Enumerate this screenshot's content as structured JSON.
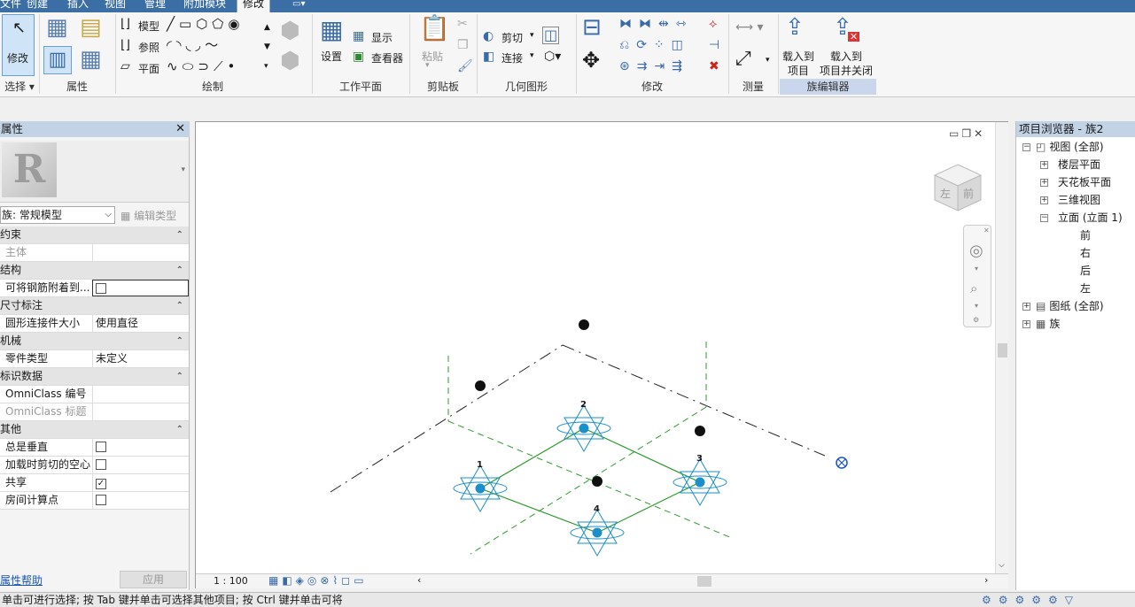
{
  "tabs": [
    "文件",
    "创建",
    "插入",
    "视图",
    "管理",
    "附加模块",
    "修改"
  ],
  "active_tab": "修改",
  "ribbon": {
    "modify_label": "修改",
    "select_label": "选择",
    "panels": {
      "properties": "属性",
      "draw": "绘制",
      "work_plane": "工作平面",
      "clipboard": "剪贴板",
      "geometry": "几何图形",
      "modify": "修改",
      "measure": "测量",
      "family_editor": "族编辑器"
    },
    "draw_items": [
      "模型",
      "参照",
      "平面"
    ],
    "work_plane_items": {
      "set": "设置",
      "show": "显示",
      "viewer": "查看器"
    },
    "clipboard_items": {
      "paste": "粘贴"
    },
    "geometry_items": {
      "cut": "剪切",
      "join": "连接"
    },
    "family_editor_items": {
      "load_to_project_1": "载入到",
      "load_to_project_2": "项目",
      "load_close_1": "载入到",
      "load_close_2": "项目并关闭"
    }
  },
  "properties": {
    "title": "属性",
    "type_selector": "族: 常规模型",
    "edit_type": "编辑类型",
    "groups": [
      {
        "name": "约束",
        "rows": [
          {
            "key": "主体",
            "value": "",
            "disabled": true
          }
        ]
      },
      {
        "name": "结构",
        "rows": [
          {
            "key": "可将钢筋附着到...",
            "checkbox": false
          }
        ]
      },
      {
        "name": "尺寸标注",
        "rows": [
          {
            "key": "圆形连接件大小",
            "value": "使用直径"
          }
        ]
      },
      {
        "name": "机械",
        "rows": [
          {
            "key": "零件类型",
            "value": "未定义"
          }
        ]
      },
      {
        "name": "标识数据",
        "rows": [
          {
            "key": "OmniClass 编号",
            "value": ""
          },
          {
            "key": "OmniClass 标题",
            "value": "",
            "disabled": true
          }
        ]
      },
      {
        "name": "其他",
        "rows": [
          {
            "key": "总是垂直",
            "checkbox": false
          },
          {
            "key": "加载时剪切的空心",
            "checkbox": false
          },
          {
            "key": "共享",
            "checkbox": true
          },
          {
            "key": "房间计算点",
            "checkbox": false
          }
        ]
      }
    ],
    "help_link": "属性帮助",
    "apply_button": "应用"
  },
  "canvas": {
    "scale": "1 : 100",
    "viewcube_faces": {
      "left": "左",
      "front": "前"
    },
    "connector_labels": [
      "1",
      "2",
      "3",
      "4"
    ]
  },
  "browser": {
    "title": "项目浏览器 - 族2",
    "items": [
      {
        "label": "视图 (全部)",
        "level": 0
      },
      {
        "label": "楼层平面",
        "level": 1
      },
      {
        "label": "天花板平面",
        "level": 1
      },
      {
        "label": "三维视图",
        "level": 1
      },
      {
        "label": "立面 (立面 1)",
        "level": 1
      },
      {
        "label": "前",
        "level": 2
      },
      {
        "label": "右",
        "level": 2
      },
      {
        "label": "后",
        "level": 2
      },
      {
        "label": "左",
        "level": 2
      },
      {
        "label": "图纸 (全部)",
        "level": 0
      },
      {
        "label": "族",
        "level": 0
      }
    ]
  },
  "status_text": "单击可进行选择; 按 Tab 键并单击可选择其他项目; 按 Ctrl 键并单击可将",
  "colors": {
    "accent": "#3b6ea5",
    "connector": "#1a8fc9",
    "ref_line": "#2e9a2e",
    "selection": "#cfe4f7"
  }
}
